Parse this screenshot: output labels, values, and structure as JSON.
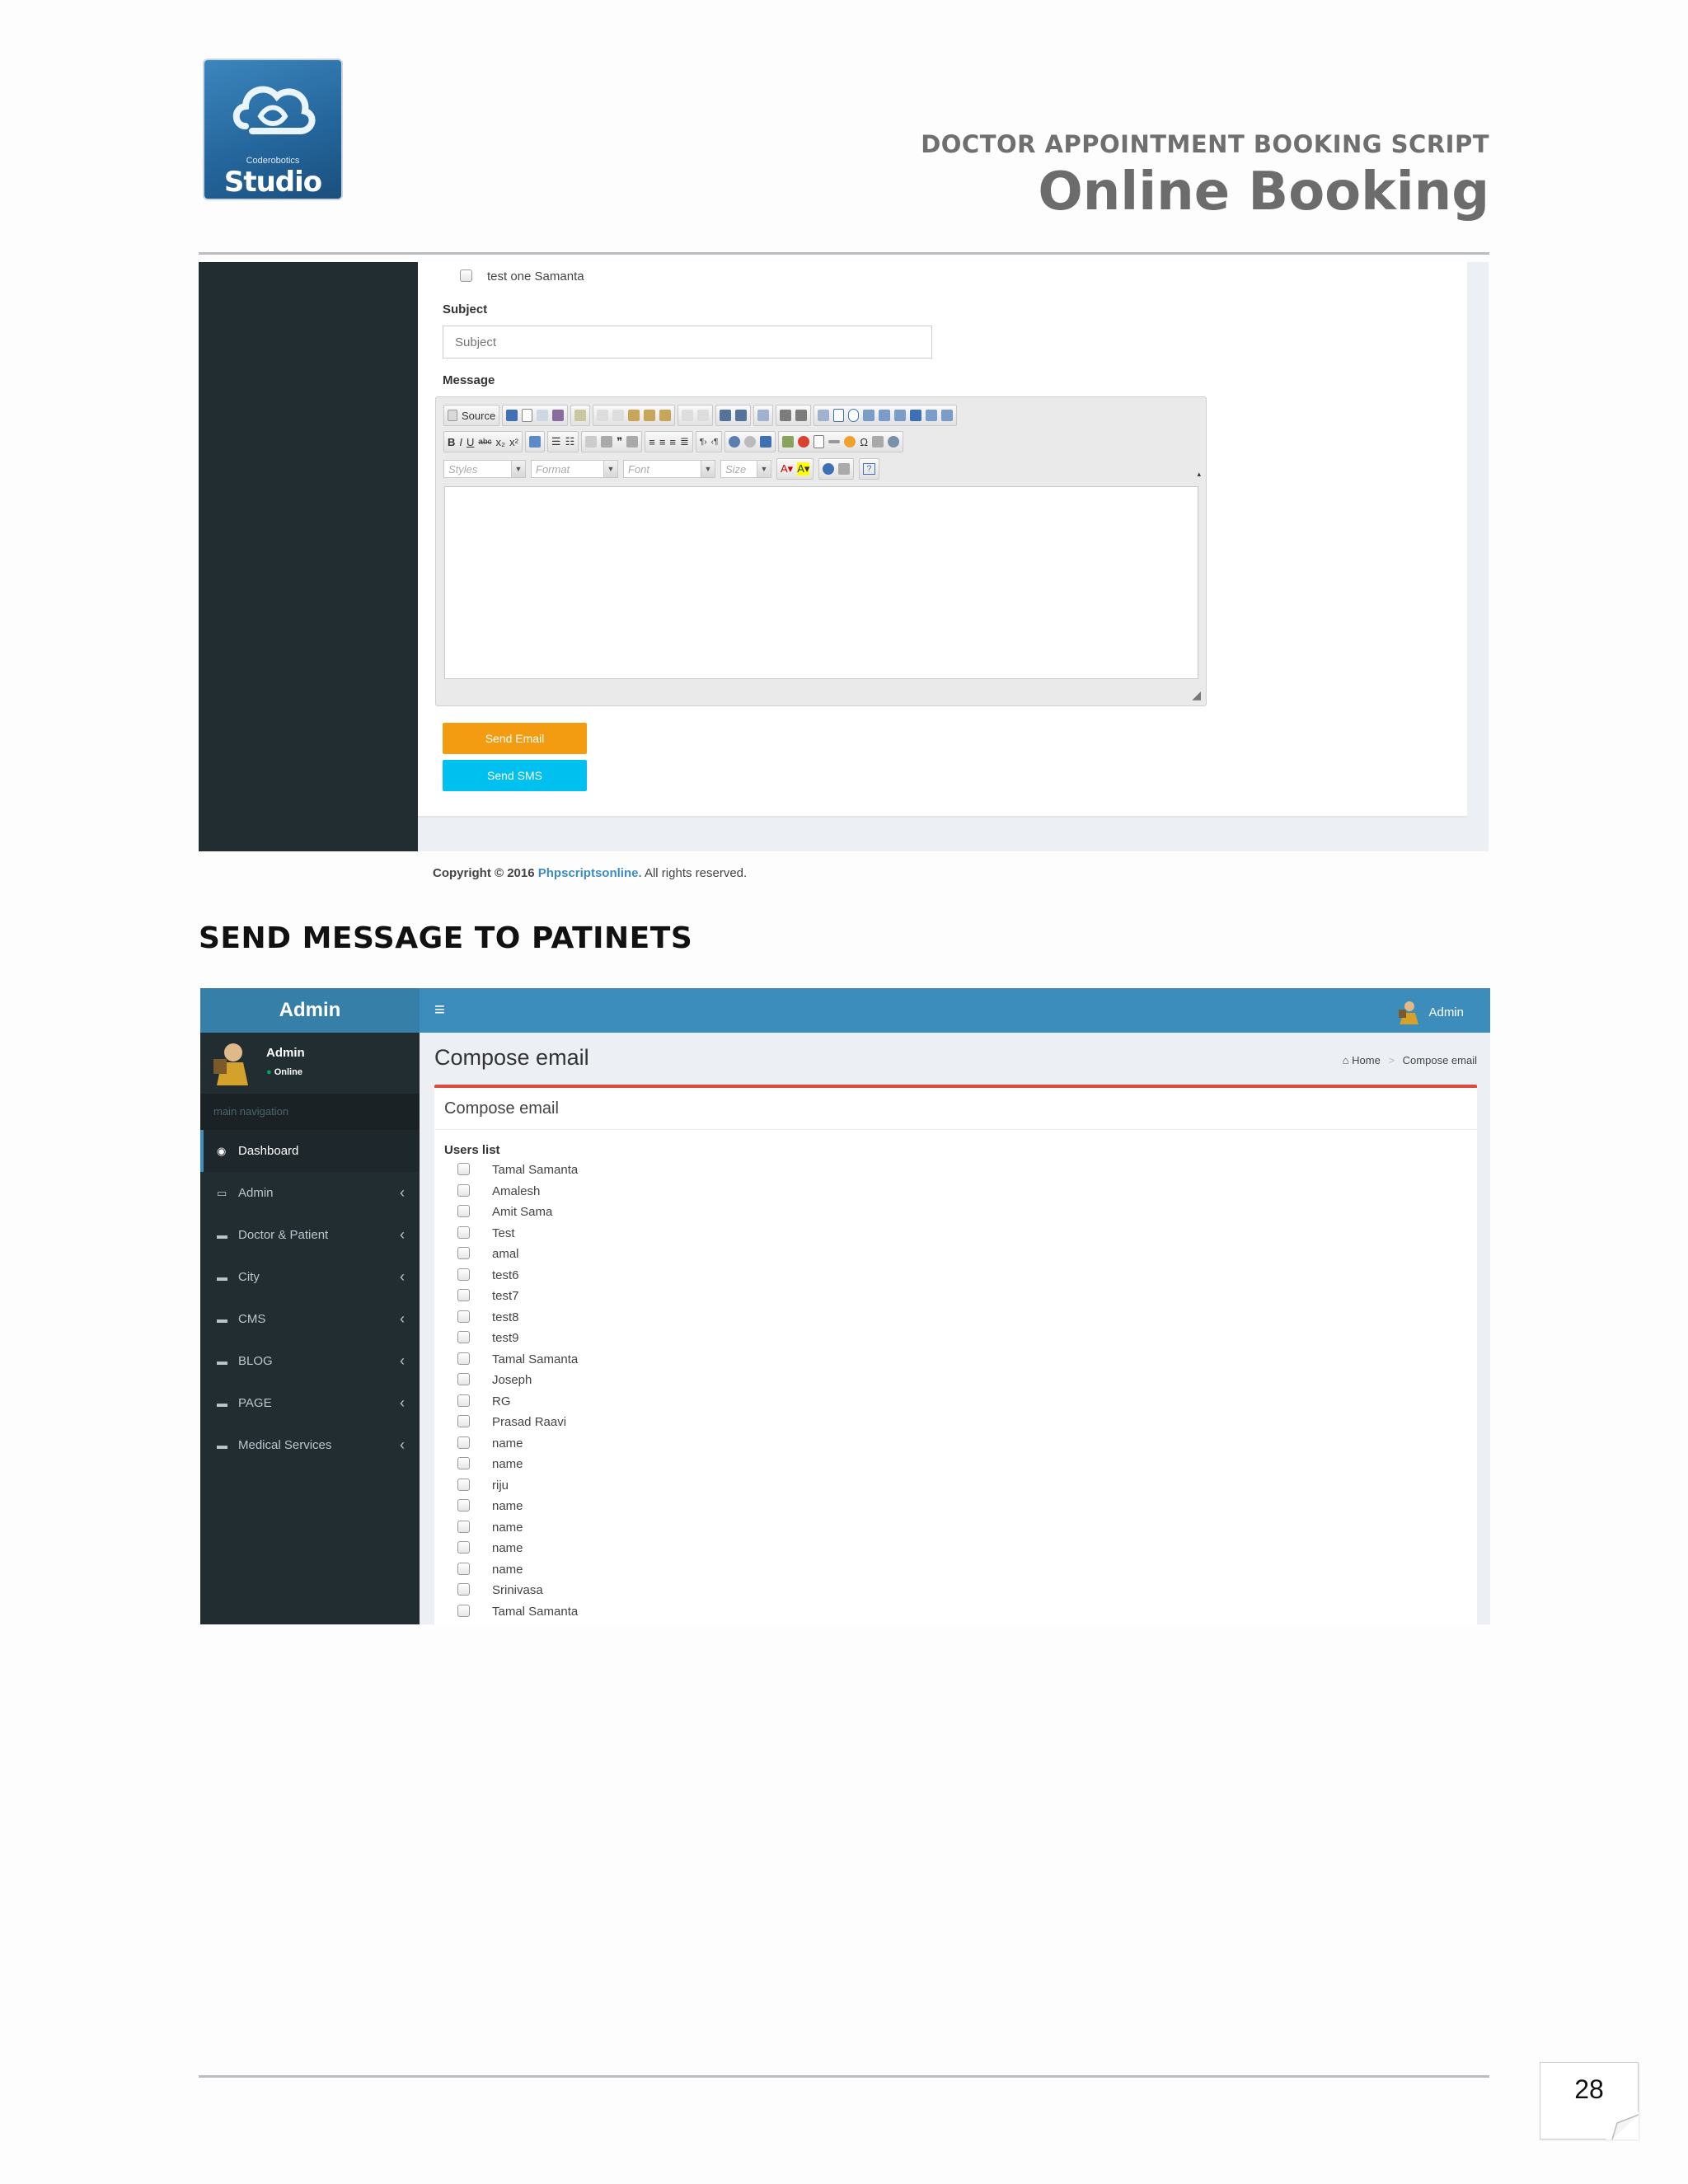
{
  "header": {
    "logo_small": "Coderobotics",
    "logo_big": "Studio",
    "doc_title": "DOCTOR APPOINTMENT BOOKING SCRIPT",
    "doc_subtitle": "Online Booking"
  },
  "shot1": {
    "checkbox_label": "test one Samanta",
    "subject_label": "Subject",
    "subject_placeholder": "Subject",
    "message_label": "Message",
    "toolbar_source": "Source",
    "combo_styles": "Styles",
    "combo_format": "Format",
    "combo_font": "Font",
    "combo_size": "Size",
    "send_email": "Send Email",
    "send_sms": "Send SMS",
    "copyright_prefix": "Copyright © 2016",
    "copyright_link": "Phpscriptsonline.",
    "copyright_suffix": "All rights reserved.",
    "colors": {
      "send_email": "#f39c12",
      "send_sms": "#00c0ef"
    }
  },
  "section_heading": "SEND MESSAGE TO PATINETS",
  "shot2": {
    "brand": "Admin",
    "top_user": "Admin",
    "panel_name": "Admin",
    "panel_status": "Online",
    "nav_header": "main navigation",
    "menu": [
      {
        "label": "Dashboard",
        "icon": "dashboard-icon"
      },
      {
        "label": "Admin",
        "icon": "laptop-icon"
      },
      {
        "label": "Doctor & Patient",
        "icon": "folder-icon"
      },
      {
        "label": "City",
        "icon": "folder-icon"
      },
      {
        "label": "CMS",
        "icon": "folder-icon"
      },
      {
        "label": "BLOG",
        "icon": "folder-icon"
      },
      {
        "label": "PAGE",
        "icon": "folder-icon"
      },
      {
        "label": "Medical Services",
        "icon": "folder-icon"
      }
    ],
    "page_title": "Compose email",
    "breadcrumb_home": "Home",
    "breadcrumb_sep": ">",
    "breadcrumb_current": "Compose email",
    "box_title": "Compose email",
    "users_list_label": "Users list",
    "users": [
      "Tamal Samanta",
      "Amalesh",
      "Amit Sama",
      "Test",
      "amal",
      "test6",
      "test7",
      "test8",
      "test9",
      "Tamal Samanta",
      "Joseph",
      "RG",
      "Prasad Raavi",
      "name",
      "name",
      "riju",
      "name",
      "name",
      "name",
      "name",
      "Srinivasa",
      "Tamal Samanta"
    ],
    "colors": {
      "navbar": "#3c8dbc",
      "sidebar": "#222d32",
      "box_border": "#dd4b39"
    }
  },
  "page_number": "28"
}
